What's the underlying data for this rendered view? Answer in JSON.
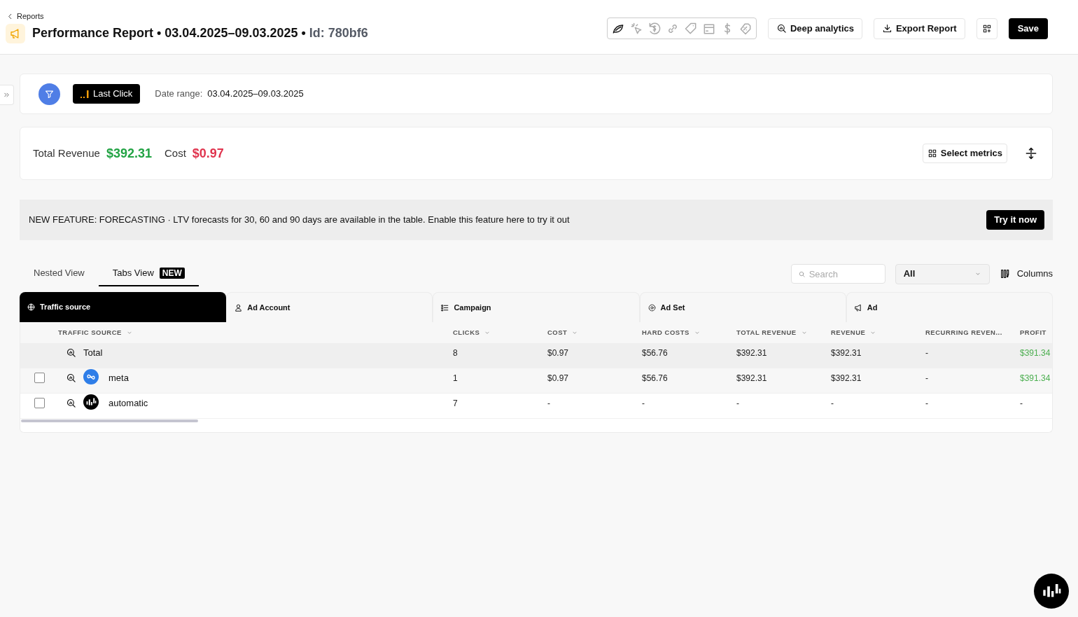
{
  "header": {
    "back_link": "Reports",
    "title": "Performance Report • 03.04.2025–09.03.2025 •",
    "id": "Id: 780bf6",
    "toolbar_icons": [
      {
        "kind": "leaf",
        "selected": true
      },
      {
        "kind": "cursor",
        "selected": false
      },
      {
        "kind": "refund",
        "selected": false
      },
      {
        "kind": "link",
        "selected": false
      },
      {
        "kind": "tag",
        "selected": false
      },
      {
        "kind": "box",
        "selected": false
      },
      {
        "kind": "dollar",
        "selected": false
      },
      {
        "kind": "discount",
        "selected": false
      }
    ],
    "buttons": [
      {
        "kind": "analytics",
        "label": "Deep analytics"
      },
      {
        "kind": "export",
        "label": "Export Report"
      },
      {
        "kind": "grid"
      },
      {
        "kind": "save",
        "label": "Save"
      }
    ]
  },
  "filter_bar": {
    "attribution": "Last Click",
    "date_label": "Date range:",
    "date_value": "03.04.2025–09.03.2025"
  },
  "summary": {
    "metrics": [
      {
        "label": "Total Revenue",
        "value": "$392.31",
        "color": "#22a344"
      },
      {
        "label": "Cost",
        "value": "$0.97",
        "color": "#e0344e"
      }
    ],
    "select_metrics": "Select metrics"
  },
  "banner": {
    "text": "NEW FEATURE: FORECASTING · LTV forecasts for 30, 60 and 90 days are available in the table. Enable this feature here to try it out",
    "button": "Try it now"
  },
  "view_tabs": [
    {
      "label": "Nested View",
      "selected": false
    },
    {
      "label": "Tabs View",
      "selected": true,
      "badge": "NEW"
    }
  ],
  "search": {
    "placeholder": "Search"
  },
  "filter_select": {
    "value": "All"
  },
  "columns_button": "Columns",
  "entity_tabs": [
    {
      "label": "Traffic source",
      "selected": true
    },
    {
      "label": "Ad Account",
      "selected": false
    },
    {
      "label": "Campaign",
      "selected": false
    },
    {
      "label": "Ad Set",
      "selected": false
    },
    {
      "label": "Ad",
      "selected": false
    }
  ],
  "table": {
    "columns": [
      {
        "label": "TRAFFIC SOURCE"
      },
      {
        "label": "CLICKS"
      },
      {
        "label": "COST"
      },
      {
        "label": "HARD COSTS"
      },
      {
        "label": "TOTAL REVENUE"
      },
      {
        "label": "REVENUE"
      },
      {
        "label": "RECURRING REVEN..."
      },
      {
        "label": "PROFIT",
        "color": "#4caf50"
      }
    ],
    "rows": [
      {
        "kind": "total",
        "cells": [
          "Total",
          "8",
          "$0.97",
          "$56.76",
          "$392.31",
          "$392.31",
          "-",
          "$391.34"
        ]
      },
      {
        "kind": "meta",
        "checked": false,
        "cells": [
          "meta",
          "1",
          "$0.97",
          "$56.76",
          "$392.31",
          "$392.31",
          "-",
          "$391.34"
        ]
      },
      {
        "kind": "logo",
        "checked": false,
        "cells": [
          "automatic",
          "7",
          "-",
          "-",
          "-",
          "-",
          "-",
          "-"
        ]
      }
    ]
  }
}
